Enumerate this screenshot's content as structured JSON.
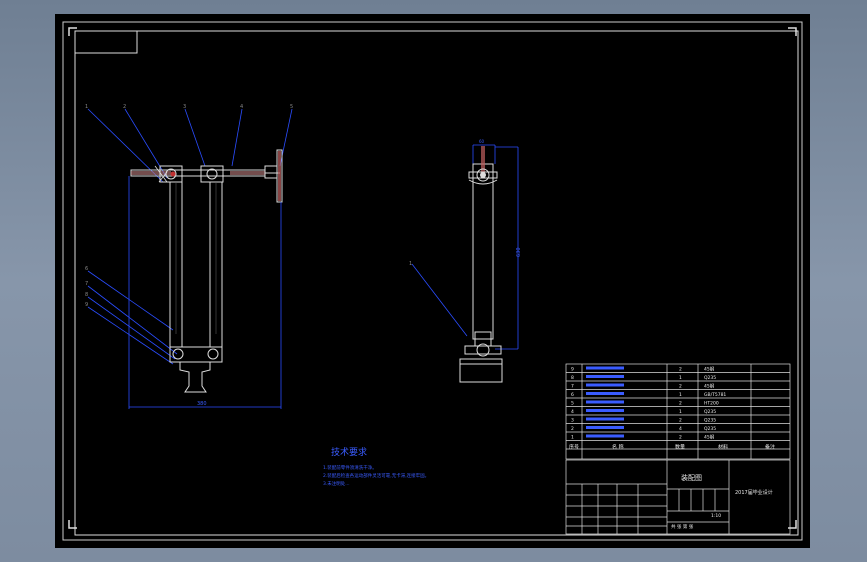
{
  "drawing": {
    "tech_title": "技术要求",
    "tech_notes": [
      "1.装配前零件须清洗干净。",
      "2.装配后检查各运动部件灵活可靠,无卡滞,连接牢固。",
      "3.未注明处..."
    ],
    "dimension_front": "380",
    "dimension_side_top": "60",
    "dimension_side_height": "630",
    "bom_rows": [
      {
        "no": "9",
        "name": "",
        "qty": "2",
        "material": "45钢",
        "note": ""
      },
      {
        "no": "8",
        "name": "",
        "qty": "1",
        "material": "Q235",
        "note": ""
      },
      {
        "no": "7",
        "name": "",
        "qty": "2",
        "material": "45钢",
        "note": ""
      },
      {
        "no": "6",
        "name": "",
        "qty": "1",
        "material": "GB/T5781",
        "note": ""
      },
      {
        "no": "5",
        "name": "",
        "qty": "2",
        "material": "HT200",
        "note": ""
      },
      {
        "no": "4",
        "name": "",
        "qty": "1",
        "material": "Q235",
        "note": ""
      },
      {
        "no": "3",
        "name": "",
        "qty": "2",
        "material": "Q235",
        "note": ""
      },
      {
        "no": "2",
        "name": "",
        "qty": "4",
        "material": "Q235",
        "note": ""
      },
      {
        "no": "1",
        "name": "",
        "qty": "2",
        "material": "45钢",
        "note": ""
      }
    ],
    "bom_header": {
      "no": "序号",
      "name": "名 称",
      "qty": "数量",
      "material": "材料",
      "note": "备注"
    },
    "title_block": {
      "drawing_name": "装配图",
      "company": "2017届毕业设计",
      "scale": "1:10",
      "sheet": "共 张 第 张"
    }
  }
}
